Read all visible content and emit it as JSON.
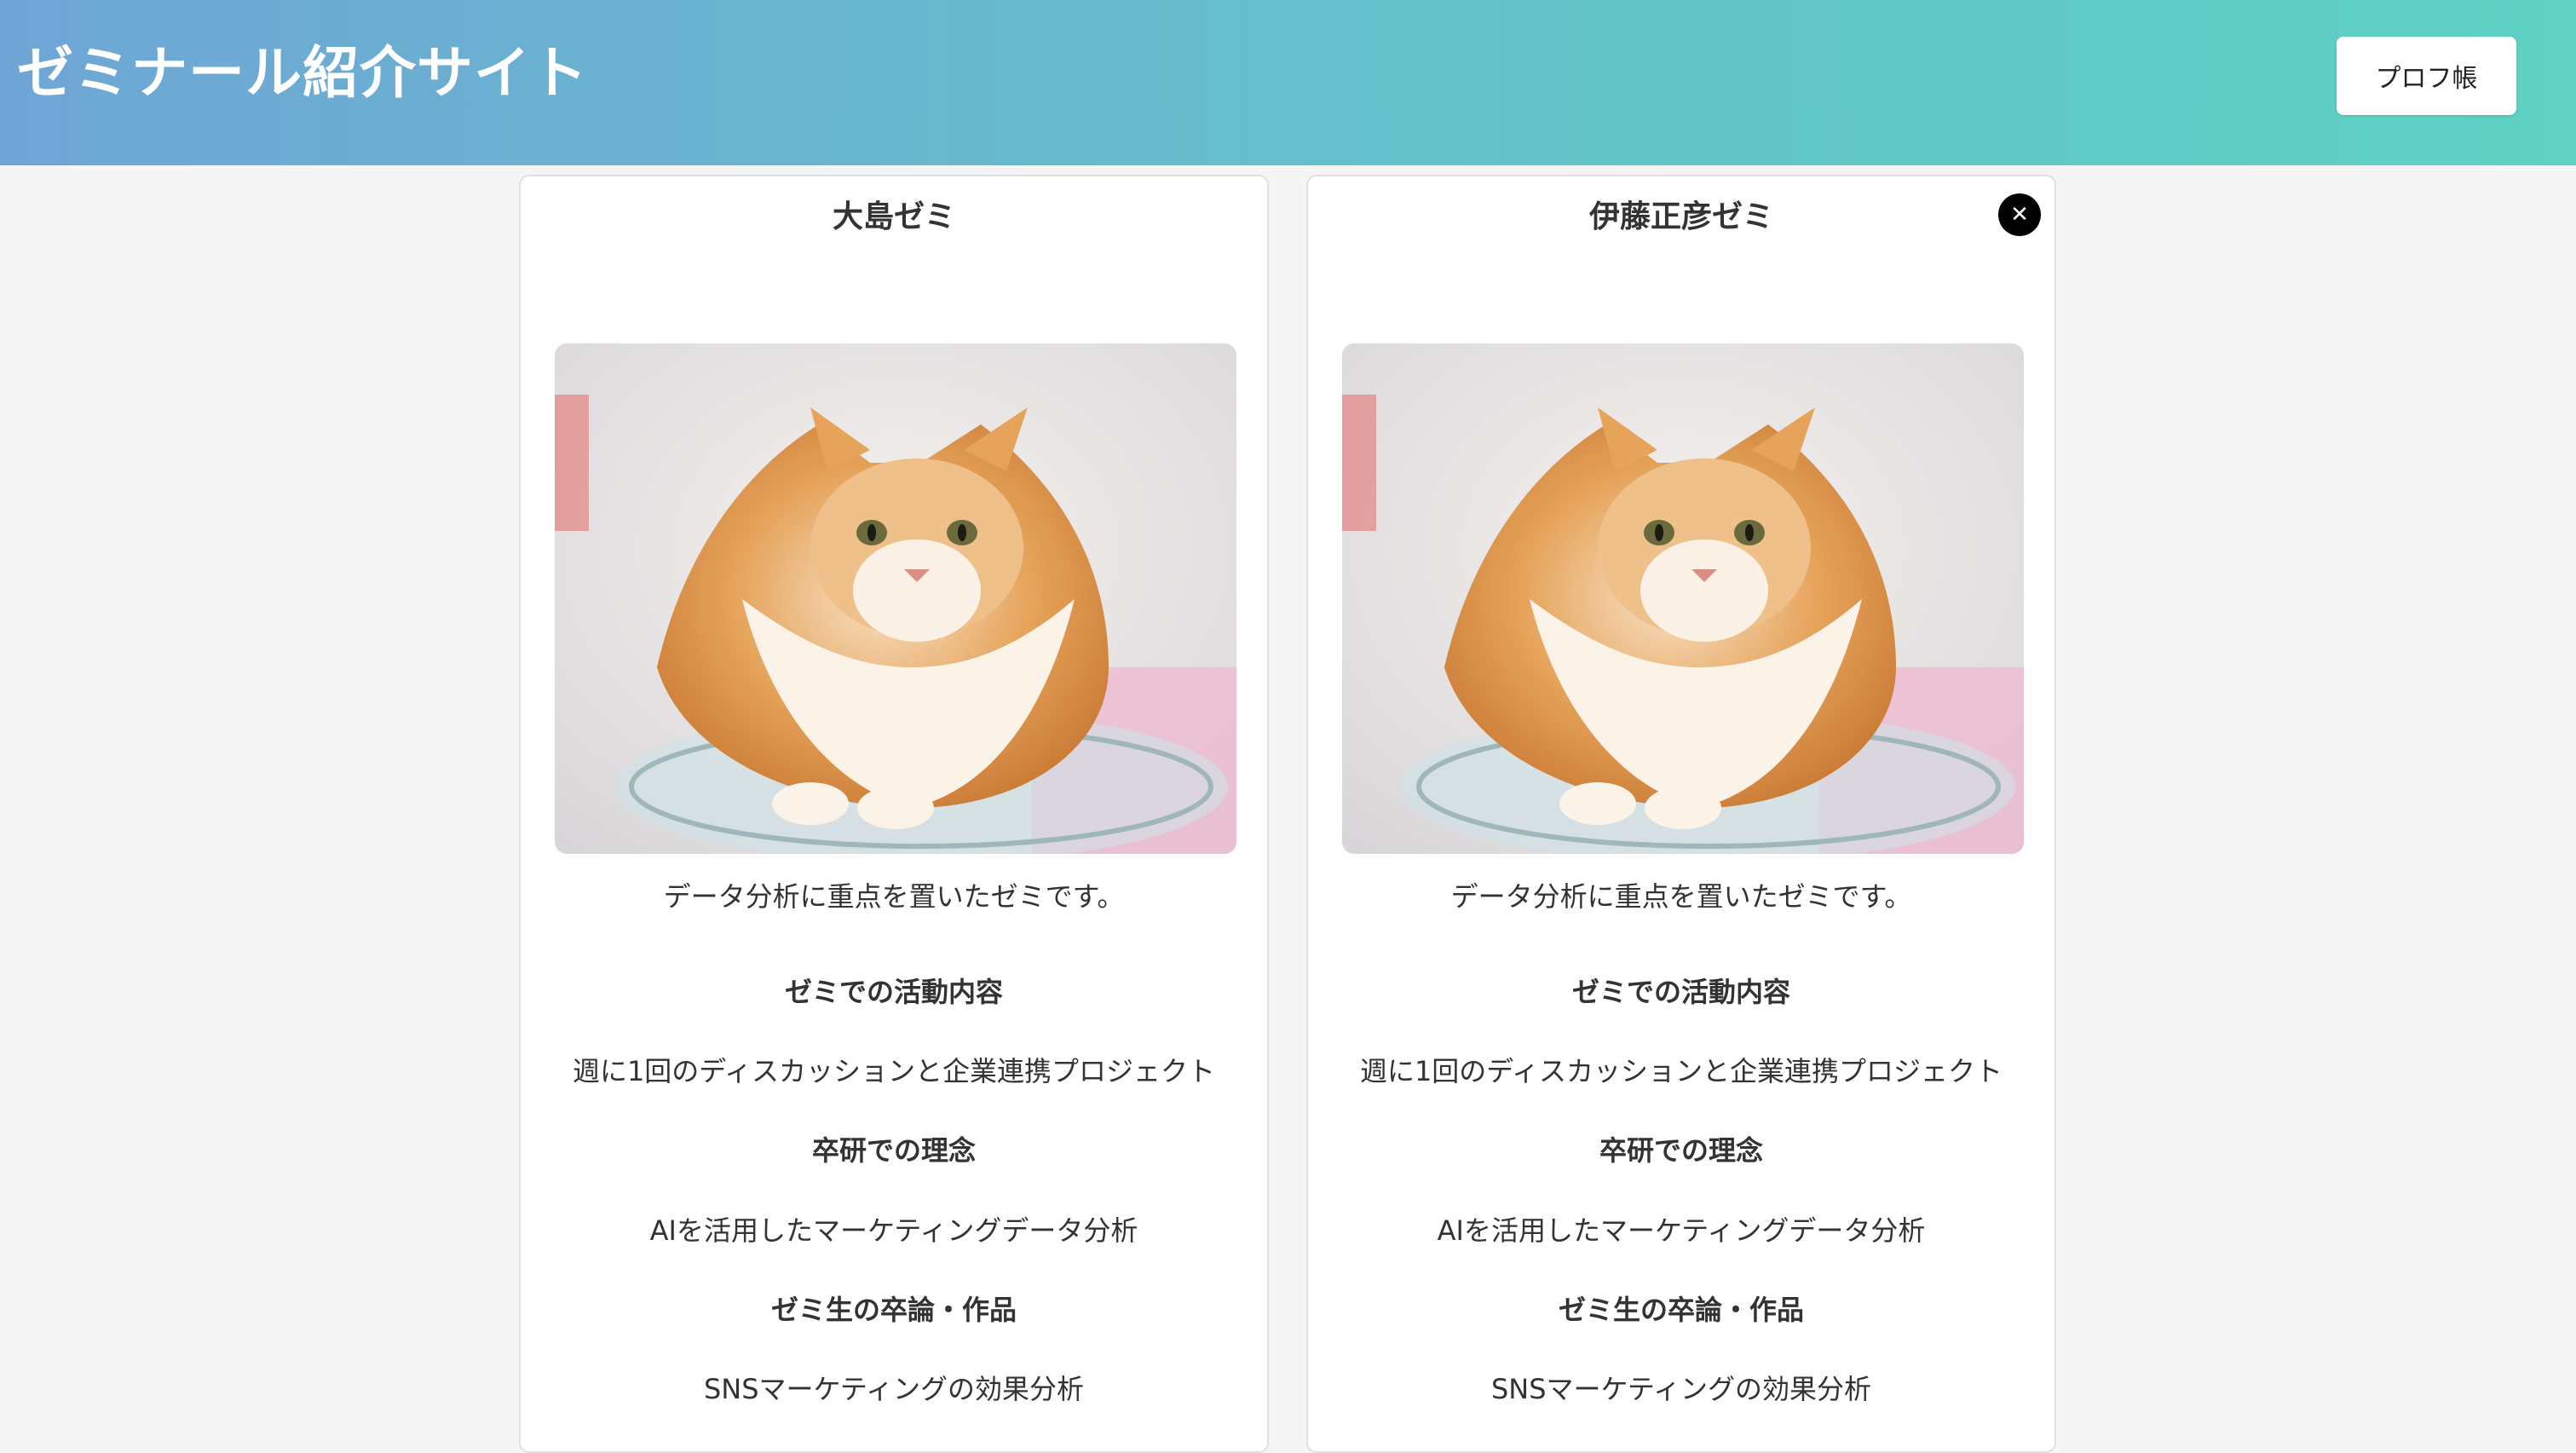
{
  "header": {
    "title": "ゼミナール紹介サイト",
    "button_label": "プロフ帳",
    "gradient_start": "#6fa6d6",
    "gradient_end": "#5fd2c3"
  },
  "cards": [
    {
      "name": "大島ゼミ",
      "image_icon": "cat-photo",
      "description": "データ分析に重点を置いたゼミです。",
      "activity_heading": "ゼミでの活動内容",
      "activity_text": "週に1回のディスカッションと企業連携プロジェクト",
      "philosophy_heading": "卒研での理念",
      "philosophy_text": "AIを活用したマーケティングデータ分析",
      "works_heading": "ゼミ生の卒論・作品",
      "works_text": "SNSマーケティングの効果分析"
    },
    {
      "name": "伊藤正彦ゼミ",
      "image_icon": "cat-photo",
      "close_icon": "close-icon",
      "close_symbol": "✕",
      "description": "データ分析に重点を置いたゼミです。",
      "activity_heading": "ゼミでの活動内容",
      "activity_text": "週に1回のディスカッションと企業連携プロジェクト",
      "philosophy_heading": "卒研での理念",
      "philosophy_text": "AIを活用したマーケティングデータ分析",
      "works_heading": "ゼミ生の卒論・作品",
      "works_text": "SNSマーケティングの効果分析"
    }
  ]
}
